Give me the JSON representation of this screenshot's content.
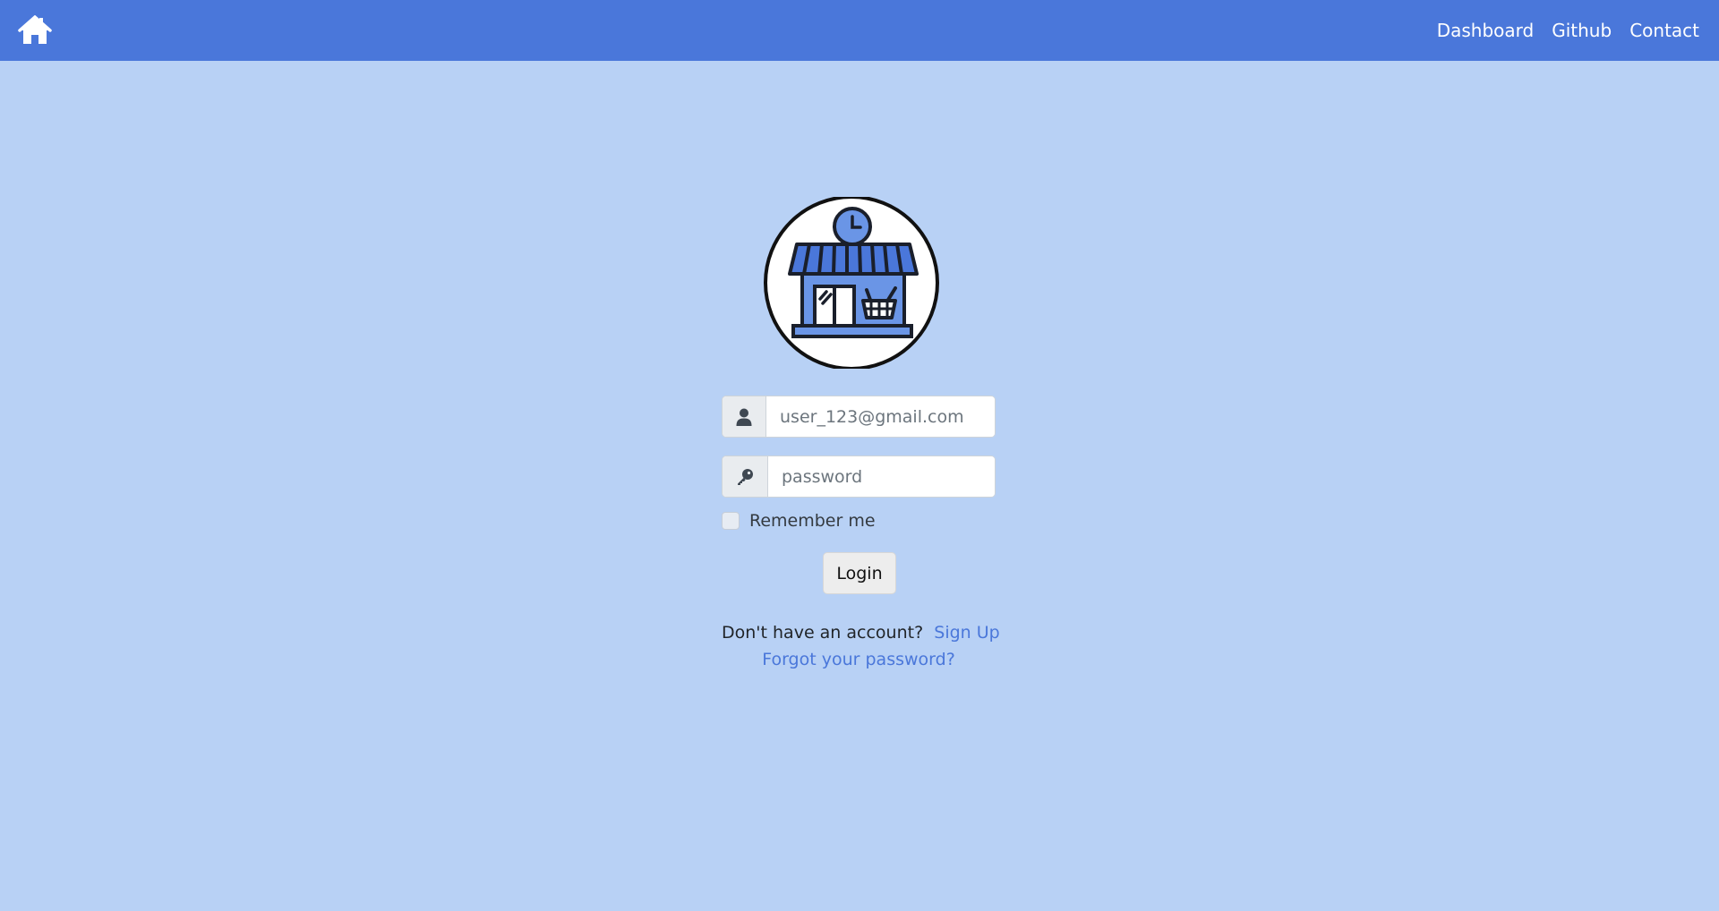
{
  "navbar": {
    "home_icon": "home-icon",
    "links": [
      "Dashboard",
      "Github",
      "Contact"
    ],
    "background": "#4a77da"
  },
  "logo": {
    "icon": "storefront-clock-logo"
  },
  "form": {
    "email": {
      "icon": "user-icon",
      "placeholder": "user_123@gmail.com",
      "value": ""
    },
    "password": {
      "icon": "key-icon",
      "placeholder": "password",
      "value": ""
    },
    "remember_label": "Remember me",
    "remember_checked": false,
    "login_label": "Login"
  },
  "footer_links": {
    "signup_prompt": "Don't have an account?",
    "signup_label": "Sign Up",
    "forgot_label": "Forgot your password?"
  },
  "colors": {
    "page_background": "#b8d1f5",
    "accent": "#4a77da"
  }
}
